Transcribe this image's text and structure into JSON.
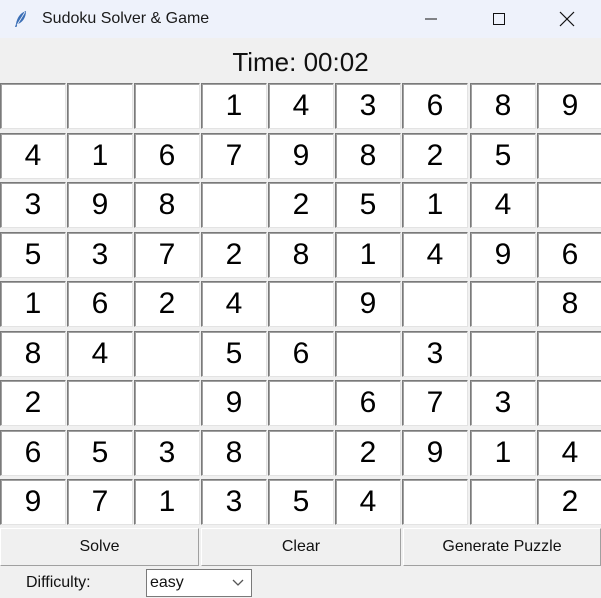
{
  "window": {
    "title": "Sudoku Solver & Game",
    "icon": "feather-icon",
    "controls": [
      "minimize-icon",
      "maximize-icon",
      "close-icon"
    ]
  },
  "timer": {
    "text": "Time: 00:02"
  },
  "grid": {
    "rows": [
      [
        "",
        "",
        "",
        "1",
        "4",
        "3",
        "6",
        "8",
        "9"
      ],
      [
        "4",
        "1",
        "6",
        "7",
        "9",
        "8",
        "2",
        "5",
        ""
      ],
      [
        "3",
        "9",
        "8",
        "",
        "2",
        "5",
        "1",
        "4",
        ""
      ],
      [
        "5",
        "3",
        "7",
        "2",
        "8",
        "1",
        "4",
        "9",
        "6"
      ],
      [
        "1",
        "6",
        "2",
        "4",
        "",
        "9",
        "",
        "",
        "8"
      ],
      [
        "8",
        "4",
        "",
        "5",
        "6",
        "",
        "3",
        "",
        ""
      ],
      [
        "2",
        "",
        "",
        "9",
        "",
        "6",
        "7",
        "3",
        ""
      ],
      [
        "6",
        "5",
        "3",
        "8",
        "",
        "2",
        "9",
        "1",
        "4"
      ],
      [
        "9",
        "7",
        "1",
        "3",
        "5",
        "4",
        "",
        "",
        "2"
      ]
    ]
  },
  "buttons": {
    "solve": "Solve",
    "clear": "Clear",
    "generate": "Generate Puzzle"
  },
  "difficulty": {
    "label": "Difficulty:",
    "value": "easy"
  }
}
